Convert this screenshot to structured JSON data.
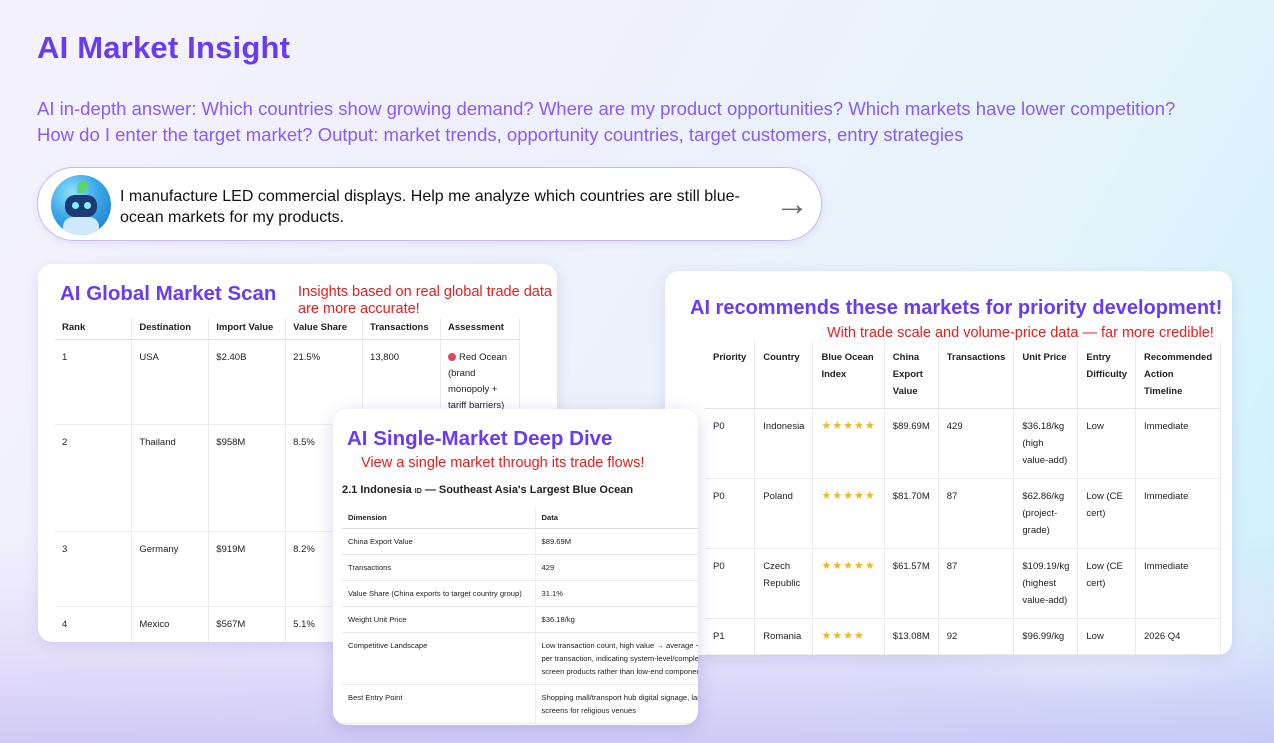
{
  "header": {
    "title": "AI Market Insight",
    "subtitle_line1": "AI in-depth answer: Which countries show growing demand? Where are my product opportunities? Which markets have lower competition?",
    "subtitle_line2": "How do I enter the target market? Output: market trends, opportunity countries, target customers, entry strategies"
  },
  "prompt": {
    "text": "I manufacture LED commercial displays. Help me analyze which countries are still blue-ocean markets for my products.",
    "send_icon": "→"
  },
  "scan": {
    "title": "AI Global Market Scan",
    "note": "Insights based on real global trade data are more accurate!",
    "headers": [
      "Rank",
      "Destination",
      "Import Value",
      "Value Share",
      "Transactions",
      "Assessment"
    ],
    "rows": [
      {
        "rank": "1",
        "destination": "USA",
        "import": "$2.40B",
        "share": "21.5%",
        "tx": "13,800",
        "assessment": "Red Ocean (brand monopoly + tariff barriers)"
      },
      {
        "rank": "2",
        "destination": "Thailand",
        "import": "$958M",
        "share": "8.5%",
        "tx": "",
        "assessment": ""
      },
      {
        "rank": "3",
        "destination": "Germany",
        "import": "$919M",
        "share": "8.2%",
        "tx": "",
        "assessment": ""
      },
      {
        "rank": "4",
        "destination": "Mexico",
        "import": "$567M",
        "share": "5.1%",
        "tx": "",
        "assessment": ""
      }
    ]
  },
  "recommend": {
    "title": "AI recommends these markets for priority development!",
    "note": "With trade scale and volume-price data — far more credible!",
    "headers": [
      "Priority",
      "Country",
      "Blue Ocean Index",
      "China Export Value",
      "Transactions",
      "Unit Price",
      "Entry Difficulty",
      "Recommended Action Timeline"
    ],
    "rows": [
      {
        "priority": "P0",
        "country": "Indonesia",
        "stars": "★★★★★",
        "export": "$89.69M",
        "tx": "429",
        "price": "$36.18/kg (high value-add)",
        "difficulty": "Low",
        "timeline": "Immediate"
      },
      {
        "priority": "P0",
        "country": "Poland",
        "stars": "★★★★★",
        "export": "$81.70M",
        "tx": "87",
        "price": "$62.86/kg (project-grade)",
        "difficulty": "Low (CE cert)",
        "timeline": "Immediate"
      },
      {
        "priority": "P0",
        "country": "Czech Republic",
        "stars": "★★★★★",
        "export": "$61.57M",
        "tx": "87",
        "price": "$109.19/kg (highest value-add)",
        "difficulty": "Low (CE cert)",
        "timeline": "Immediate"
      },
      {
        "priority": "P1",
        "country": "Romania",
        "stars": "★★★★",
        "export": "$13.08M",
        "tx": "92",
        "price": "$96.99/kg",
        "difficulty": "Low",
        "timeline": "2026 Q4"
      }
    ]
  },
  "deep": {
    "title": "AI Single-Market Deep Dive",
    "note": "View a single market through its trade flows!",
    "heading": "2.1 Indonesia",
    "heading_code": "ID",
    "heading_rest": " — Southeast Asia's Largest Blue Ocean",
    "headers": [
      "Dimension",
      "Data"
    ],
    "rows": [
      {
        "dim": "China Export Value",
        "val": "$89.69M"
      },
      {
        "dim": "Transactions",
        "val": "429"
      },
      {
        "dim": "Value Share (China exports to target country group)",
        "val": "31.1%"
      },
      {
        "dim": "Weight Unit Price",
        "val": "$36.18/kg"
      },
      {
        "dim": "Competitive Landscape",
        "val": "Low transaction count, high value → average ~$ per transaction, indicating system-level/complet screen products rather than low-end componen"
      },
      {
        "dim": "Best Entry Point",
        "val": "Shopping mall/transport hub digital signage, lar screens for religious venues"
      }
    ]
  }
}
